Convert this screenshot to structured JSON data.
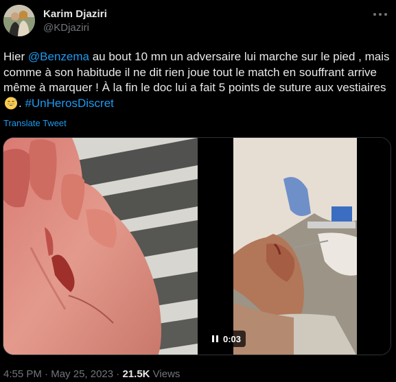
{
  "author": {
    "display_name": "Karim Djaziri",
    "handle": "@KDjaziri",
    "avatar_icon": "profile-photo"
  },
  "tweet": {
    "text_parts": {
      "p1": "Hier ",
      "mention": "@Benzema",
      "p2": " au bout 10 mn un adversaire lui marche sur le pied , mais comme à son habitude il ne dit rien joue tout le match en souffrant arrive même à marquer ! À la fin le doc lui a fait 5 points de suture aux vestiaires ",
      "emoji_name": "grinning-face-with-sweat",
      "p3": ". ",
      "hashtag": "#UnHerosDiscret"
    },
    "translate_label": "Translate Tweet"
  },
  "media": {
    "video_time": "0:03",
    "pause_icon": "pause-icon"
  },
  "footer": {
    "time": "4:55 PM",
    "separator": "·",
    "date": "May 25, 2023",
    "views_count": "21.5K",
    "views_label": "Views"
  },
  "colors": {
    "background": "#000000",
    "text": "#e7e9ea",
    "secondary": "#71767b",
    "link": "#1d9bf0"
  }
}
